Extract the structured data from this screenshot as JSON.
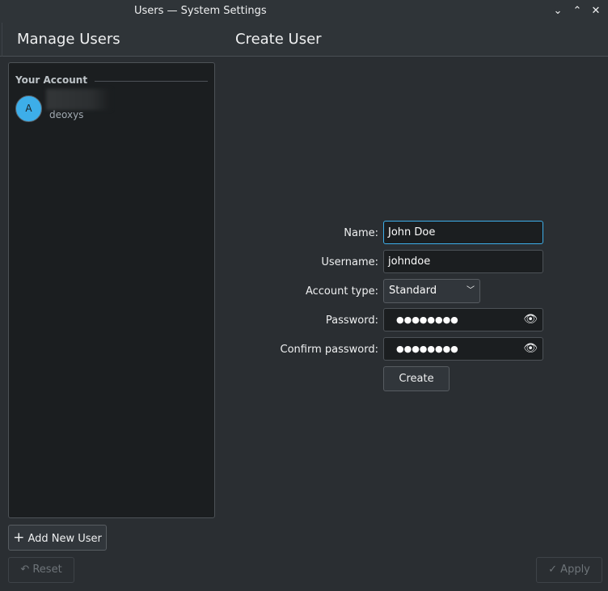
{
  "window": {
    "title": "Users — System Settings",
    "minimize": "⌄",
    "maximize": "⌃",
    "close": "✕"
  },
  "header": {
    "left_title": "Manage Users",
    "right_title": "Create User"
  },
  "sidebar": {
    "section": "Your Account",
    "account": {
      "avatar_letter": "A",
      "username": "deoxys"
    },
    "add_user_label": "Add New User",
    "add_icon": "+"
  },
  "form": {
    "name_label": "Name:",
    "name_value": "John Doe",
    "username_label": "Username:",
    "username_value": "johndoe",
    "account_type_label": "Account type:",
    "account_type_value": "Standard",
    "password_label": "Password:",
    "password_value": "●●●●●●●●",
    "confirm_label": "Confirm password:",
    "confirm_value": "●●●●●●●●",
    "eye_icon": "👁",
    "create_label": "Create"
  },
  "footer": {
    "reset_label": "Reset",
    "reset_icon": "↶",
    "apply_label": "Apply",
    "apply_icon": "✓"
  },
  "colors": {
    "accent": "#3daee9",
    "background": "#2a2e32",
    "panel": "#1b1e20"
  }
}
